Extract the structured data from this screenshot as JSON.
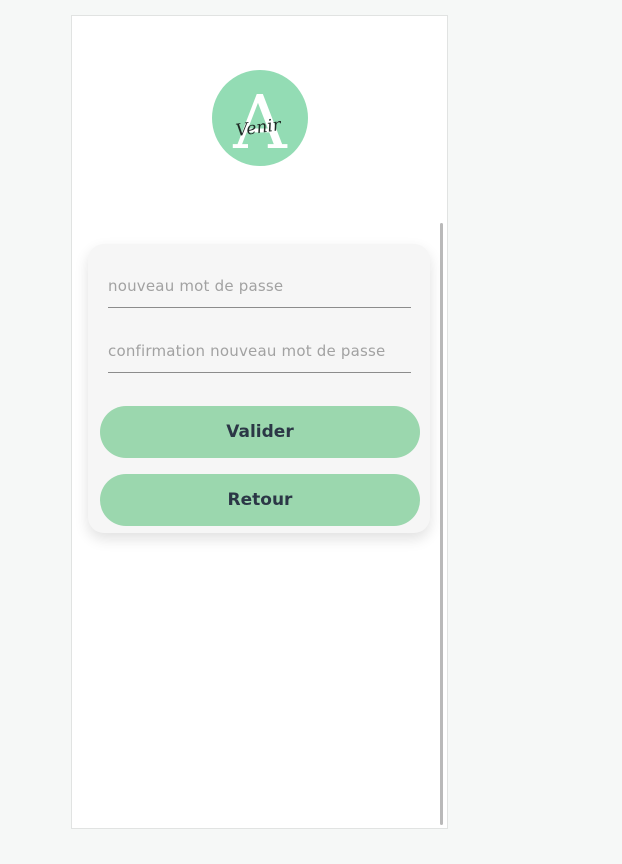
{
  "colors": {
    "page_background": "#f6f8f7",
    "logo_circle": "#93dcb4",
    "button": "#9bd7ae",
    "button_text": "#2b3746"
  },
  "logo": {
    "letter": "A",
    "script_text": "Venir"
  },
  "form": {
    "new_password": {
      "placeholder": "nouveau mot de passe",
      "value": ""
    },
    "confirm_password": {
      "placeholder": "confirmation nouveau mot de passe",
      "value": ""
    },
    "validate_label": "Valider",
    "back_label": "Retour"
  }
}
